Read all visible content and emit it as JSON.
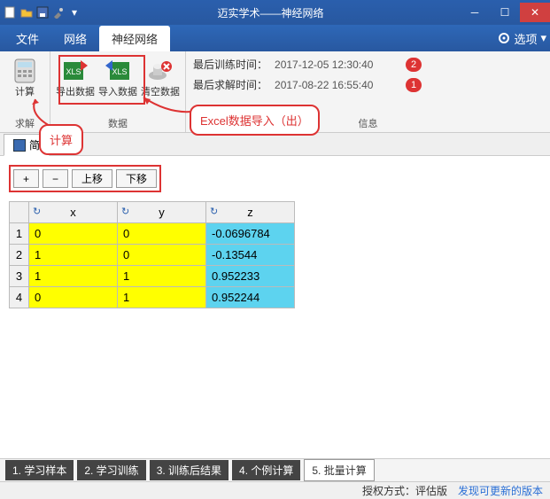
{
  "title": "迈实学术——神经网络",
  "titlebar_icons": [
    "new-icon",
    "open-icon",
    "save-icon",
    "tools-icon"
  ],
  "menubar": {
    "items": [
      "文件",
      "网络",
      "神经网络"
    ],
    "active": 2,
    "options": "选项"
  },
  "ribbon": {
    "groups": [
      {
        "label": "求解",
        "buttons": [
          {
            "icon": "calc-icon",
            "label": "计算"
          }
        ]
      },
      {
        "label": "数据",
        "buttons": [
          {
            "icon": "xls-export-icon",
            "label": "导出数据"
          },
          {
            "icon": "xls-import-icon",
            "label": "导入数据"
          },
          {
            "icon": "clear-icon",
            "label": "清空数据"
          }
        ]
      }
    ],
    "info": {
      "rows": [
        {
          "label": "最后训练时间：",
          "value": "2017-12-05 12:30:40",
          "badge": "2"
        },
        {
          "label": "最后求解时间：",
          "value": "2017-08-22 16:55:40",
          "badge": "1"
        }
      ],
      "label": "信息"
    }
  },
  "doc_tab": "简",
  "toolbar": {
    "add": "+",
    "remove": "−",
    "up": "上移",
    "down": "下移"
  },
  "table": {
    "headers": [
      "x",
      "y",
      "z"
    ],
    "rows": [
      {
        "n": "1",
        "x": "0",
        "y": "0",
        "z": "-0.0696784"
      },
      {
        "n": "2",
        "x": "1",
        "y": "0",
        "z": "-0.13544"
      },
      {
        "n": "3",
        "x": "1",
        "y": "1",
        "z": "0.952233"
      },
      {
        "n": "4",
        "x": "0",
        "y": "1",
        "z": "0.952244"
      }
    ]
  },
  "bottom_tabs": {
    "items": [
      "1. 学习样本",
      "2. 学习训练",
      "3. 训练后结果",
      "4. 个例计算",
      "5. 批量计算"
    ],
    "active": 4
  },
  "status": {
    "license": "授权方式：评估版",
    "update": "发现可更新的版本"
  },
  "callouts": {
    "c1": "计算",
    "c2": "Excel数据导入（出）"
  }
}
